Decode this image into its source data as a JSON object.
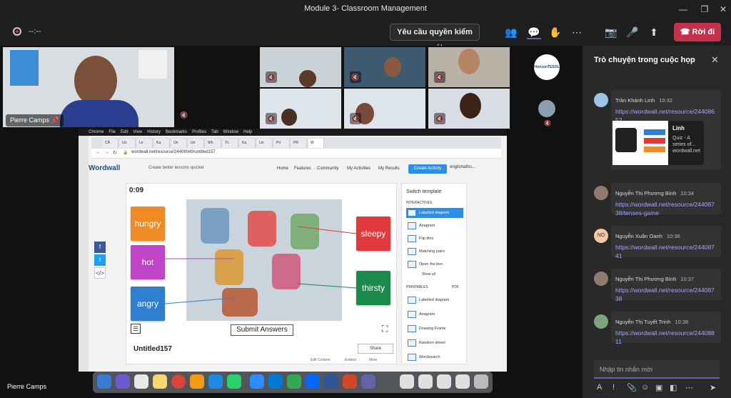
{
  "window": {
    "title": "Module 3- Classroom Management"
  },
  "toolbar": {
    "timer": "--:--",
    "request_control_label": "Yêu cầu quyền kiểm soát",
    "leave_label": "Rời đi",
    "leave_color": "#c4314b"
  },
  "participants": {
    "presenter_name": "Pierre Camps",
    "bottom_name": "Pierre Camps",
    "logo_label": "HorizonTESOL"
  },
  "screen_share": {
    "url": "wordwall.net/resource/24408049/untitled157",
    "logo": "Wordwall",
    "tagline": "Create better lessons quicker",
    "nav": [
      "Home",
      "Features",
      "Community",
      "My Activities",
      "My Results"
    ],
    "create_label": "Create Activity",
    "account": "englishatho...",
    "game": {
      "timer": "0:09",
      "words_left": [
        {
          "label": "hungry",
          "color": "#f08a24"
        },
        {
          "label": "hot",
          "color": "#c044c8"
        },
        {
          "label": "angry",
          "color": "#2e7fd0"
        }
      ],
      "words_right": [
        {
          "label": "sleepy",
          "color": "#e23a3a"
        },
        {
          "label": "thirsty",
          "color": "#1c8a4a"
        }
      ],
      "submit_label": "Submit Answers",
      "activity_name": "Untitled157",
      "share_label": "Share",
      "footer": [
        "Edit Content",
        "Embed",
        "More"
      ]
    },
    "templates": {
      "title": "Switch template",
      "interactives_label": "INTERACTIVES",
      "interactives": [
        "Labelled diagram",
        "Anagram",
        "Flip tiles",
        "Matching pairs",
        "Open the box"
      ],
      "show_all": "Show all",
      "printables_label": "PRINTABLES",
      "pdf": "PDF",
      "printables": [
        "Labelled diagram",
        "Anagram",
        "Drawing Frame",
        "Random wheel",
        "Wordsearch"
      ]
    }
  },
  "chat": {
    "header": "Trò chuyện trong cuộc họp",
    "messages": [
      {
        "name": "Trần Khánh Linh",
        "time": "10:32",
        "link": "https://wordwall.net/resource/24408652",
        "avatar": ""
      },
      {
        "name": "Nguyễn Thị Phương Bình",
        "time": "10:34",
        "link": "https://wordwall.net/resource/24408738/tenses-game",
        "avatar": ""
      },
      {
        "name": "Nguyễn Xuân Oanh",
        "time": "10:36",
        "link": "https://wordwall.net/resource/24408741",
        "avatar": "NO"
      },
      {
        "name": "Nguyễn Thị Phương Bình",
        "time": "10:37",
        "link": "https://wordwall.net/resource/24408738",
        "avatar": ""
      },
      {
        "name": "Nguyễn Thị Tuyết Trinh",
        "time": "10:38",
        "link": "https://wordwall.net/resource/24408811",
        "avatar": ""
      }
    ],
    "card": {
      "title": "Linh",
      "subtitle": "Quiz - A series of... wordwall.net"
    },
    "input_placeholder": "Nhập tin nhắn mới"
  }
}
